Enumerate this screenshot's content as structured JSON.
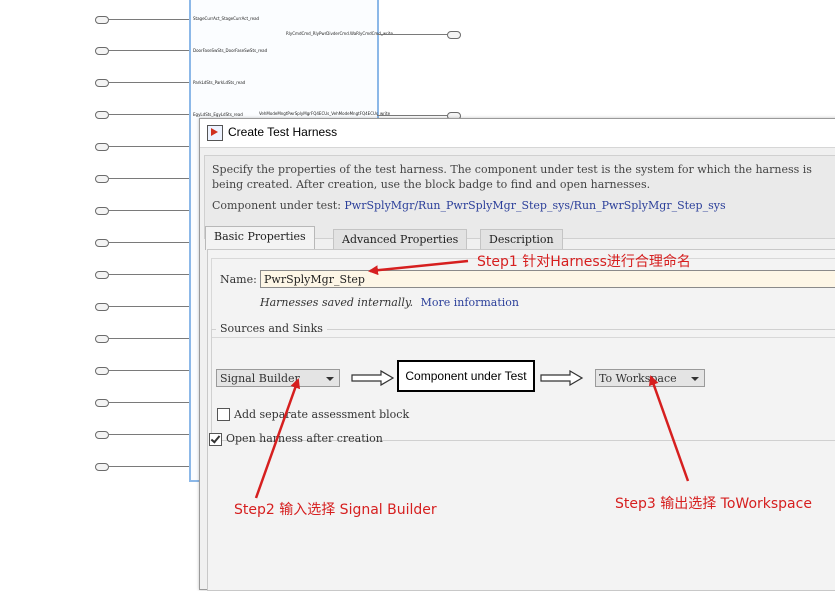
{
  "background_model": {
    "signals": [
      {
        "label": "StageCurrAct_StageCurrAct_read"
      },
      {
        "label": "RlyCmdCmd_RlyPwrDivderCmd.WaRlyCmdCmd_write"
      },
      {
        "label": "DoorFaseSwSts_DoorFaseSwSts_read"
      },
      {
        "label": "ParkLdSts_ParkLdSts_read"
      },
      {
        "label": "EgyLdSts_EgyLdSts_read"
      },
      {
        "label": "VehModeMngtPwrSplyMgrFQ4ECUs_VehModeMngtFQ4ECUs_write"
      }
    ]
  },
  "dialog": {
    "title": "Create Test Harness",
    "description": "Specify the properties of the test harness. The component under test is the system for which the harness is being created. After creation, use the block badge to find and open harnesses.",
    "component_label": "Component under test:",
    "component_path": "PwrSplyMgr/Run_PwrSplyMgr_Step_sys/Run_PwrSplyMgr_Step_sys",
    "tabs": [
      {
        "label": "Basic Properties"
      },
      {
        "label": "Advanced Properties"
      },
      {
        "label": "Description"
      }
    ],
    "name_label": "Name:",
    "name_value": "PwrSplyMgr_Step",
    "saved_note": "Harnesses saved internally.",
    "more_info": "More information",
    "sources_sinks_title": "Sources and Sinks",
    "source_value": "Signal Builder",
    "component_box": "Component under Test",
    "sink_value": "To Workspace",
    "assessment_label": "Add separate assessment block",
    "assessment_checked": false,
    "open_after_label": "Open harness after creation",
    "open_after_checked": true
  },
  "annotations": {
    "step1": "Step1 针对Harness进行合理命名",
    "step2": "Step2 输入选择 Signal Builder",
    "step3": "Step3 输出选择 ToWorkspace",
    "color": "#d61f1f"
  }
}
